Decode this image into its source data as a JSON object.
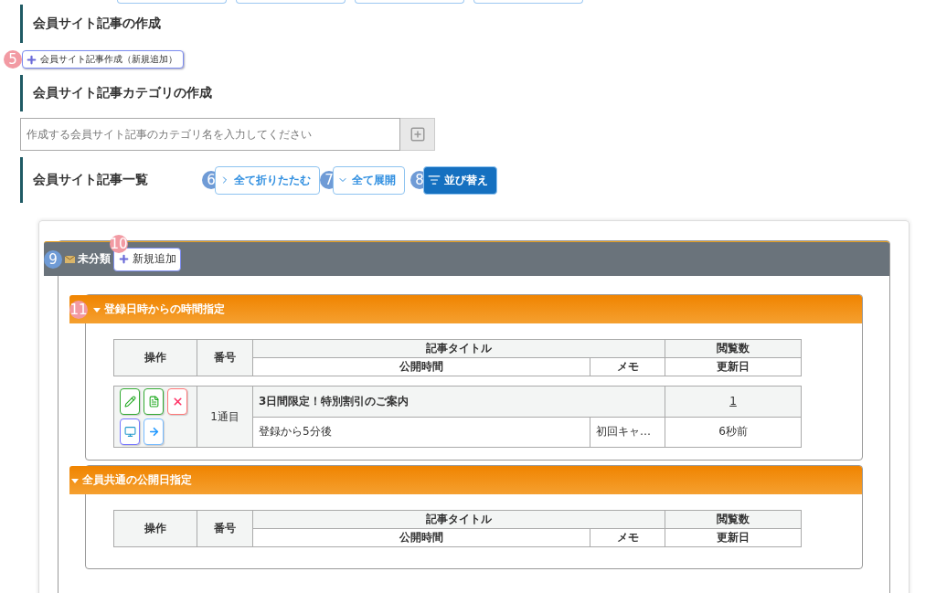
{
  "create_article": {
    "heading": "会員サイト記事の作成",
    "button": "会員サイト記事作成（新規追加）",
    "step": {
      "label": "5",
      "color": "#f29aa3"
    }
  },
  "create_category": {
    "heading": "会員サイト記事カテゴリの作成",
    "placeholder": "作成する会員サイト記事のカテゴリ名を入力してください"
  },
  "article_list": {
    "heading": "会員サイト記事一覧",
    "buttons": [
      {
        "kind": "collapse",
        "label": "全て折りたたむ",
        "step": {
          "label": "6",
          "color": "#6f9bd6"
        }
      },
      {
        "kind": "expand",
        "label": "全て展開",
        "step": {
          "label": "7",
          "color": "#6f9bd6"
        }
      },
      {
        "kind": "sort",
        "label": "並び替え",
        "step": {
          "label": "8",
          "color": "#6f9bd6"
        }
      }
    ]
  },
  "categories": [
    {
      "name": "未分類",
      "step": {
        "label": "9",
        "color": "#6f9bd6"
      },
      "add_button": "新規追加",
      "add_step": {
        "label": "10",
        "color": "#f29aa3"
      },
      "groups": [
        {
          "title": "登録日時からの時間指定",
          "expanded": true,
          "step": {
            "label": "11",
            "color": "#f29aa3"
          },
          "headers": {
            "op": "操作",
            "num": "番号",
            "title": "記事タイトル",
            "views": "閲覧数",
            "time": "公開時間",
            "memo": "メモ",
            "updated": "更新日"
          },
          "rows": [
            {
              "number": "1通目",
              "title": "3日間限定！特別割引のご案内",
              "views": "1",
              "time": "登録から5分後",
              "memo": "初回キャ…",
              "updated": "6秒前"
            }
          ]
        },
        {
          "title": "全員共通の公開日指定",
          "expanded": true,
          "headers": {
            "op": "操作",
            "num": "番号",
            "title": "記事タイトル",
            "views": "閲覧数",
            "time": "公開時間",
            "memo": "メモ",
            "updated": "更新日"
          }
        }
      ]
    }
  ]
}
